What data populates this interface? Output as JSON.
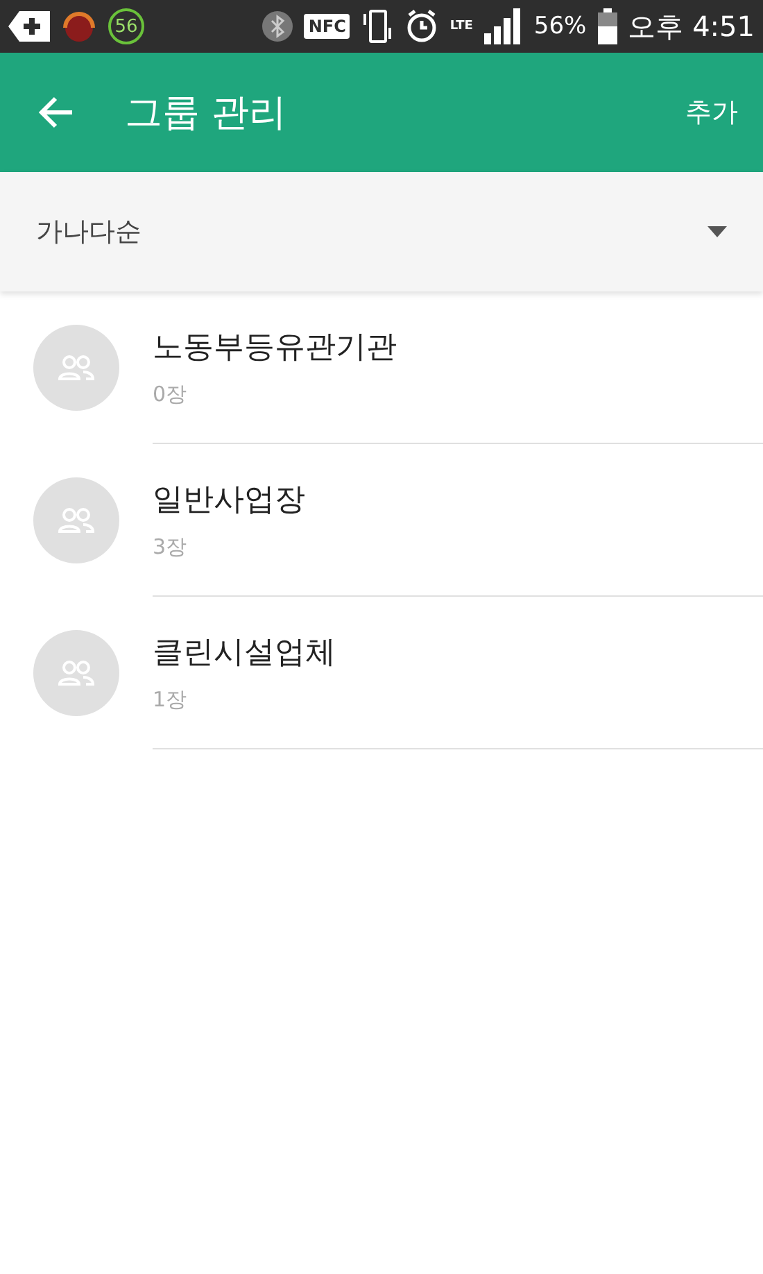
{
  "status_bar": {
    "badge": "56",
    "nfc": "NFC",
    "lte": "LTE",
    "battery": "56%",
    "time": "오후 4:51"
  },
  "app_bar": {
    "title": "그룹 관리",
    "action": "추가"
  },
  "sort": {
    "label": "가나다순"
  },
  "groups": [
    {
      "name": "노동부등유관기관",
      "count": "0장"
    },
    {
      "name": "일반사업장",
      "count": "3장"
    },
    {
      "name": "클린시설업체",
      "count": "1장"
    }
  ]
}
